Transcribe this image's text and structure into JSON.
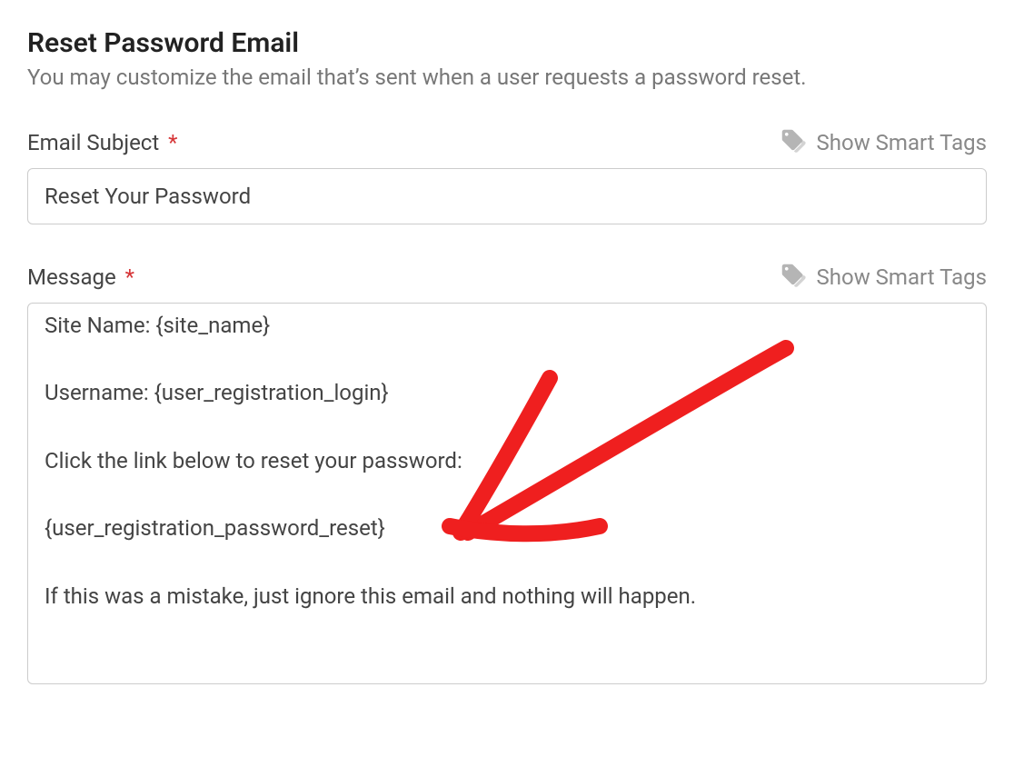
{
  "section": {
    "title": "Reset Password Email",
    "description": "You may customize the email that’s sent when a user requests a password reset."
  },
  "subject": {
    "label": "Email Subject",
    "required_marker": "*",
    "smart_tags_label": "Show Smart Tags",
    "value": "Reset Your Password"
  },
  "message": {
    "label": "Message",
    "required_marker": "*",
    "smart_tags_label": "Show Smart Tags",
    "value": "Site Name: {site_name}\n\nUsername: {user_registration_login}\n\nClick the link below to reset your password:\n\n{user_registration_password_reset}\n\nIf this was a mistake, just ignore this email and nothing will happen."
  }
}
